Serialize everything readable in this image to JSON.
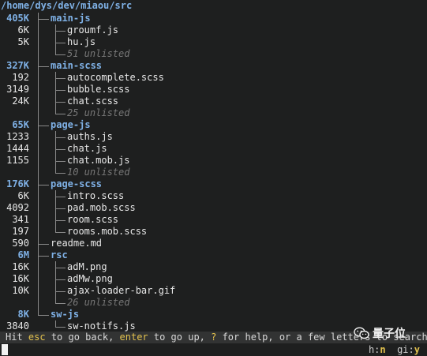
{
  "root_path": "/home/dys/dev/miaou/src",
  "rows": [
    {
      "size": "405K",
      "name": "main-js",
      "kind": "dir",
      "depth": 0
    },
    {
      "size": "6K",
      "name": "groumf.js",
      "kind": "file",
      "depth": 1
    },
    {
      "size": "5K",
      "name": "hu.js",
      "kind": "file",
      "depth": 1
    },
    {
      "size": "",
      "name": "51 unlisted",
      "kind": "unlisted",
      "depth": 1,
      "last": true
    },
    {
      "size": "327K",
      "name": "main-scss",
      "kind": "dir",
      "depth": 0
    },
    {
      "size": "192",
      "name": "autocomplete.scss",
      "kind": "file",
      "depth": 1
    },
    {
      "size": "3149",
      "name": "bubble.scss",
      "kind": "file",
      "depth": 1
    },
    {
      "size": "24K",
      "name": "chat.scss",
      "kind": "file",
      "depth": 1
    },
    {
      "size": "",
      "name": "25 unlisted",
      "kind": "unlisted",
      "depth": 1,
      "last": true
    },
    {
      "size": "65K",
      "name": "page-js",
      "kind": "dir",
      "depth": 0
    },
    {
      "size": "1233",
      "name": "auths.js",
      "kind": "file",
      "depth": 1
    },
    {
      "size": "1444",
      "name": "chat.js",
      "kind": "file",
      "depth": 1
    },
    {
      "size": "1155",
      "name": "chat.mob.js",
      "kind": "file",
      "depth": 1
    },
    {
      "size": "",
      "name": "10 unlisted",
      "kind": "unlisted",
      "depth": 1,
      "last": true
    },
    {
      "size": "176K",
      "name": "page-scss",
      "kind": "dir",
      "depth": 0
    },
    {
      "size": "6K",
      "name": "intro.scss",
      "kind": "file",
      "depth": 1
    },
    {
      "size": "4092",
      "name": "pad.mob.scss",
      "kind": "file",
      "depth": 1
    },
    {
      "size": "341",
      "name": "room.scss",
      "kind": "file",
      "depth": 1
    },
    {
      "size": "197",
      "name": "rooms.mob.scss",
      "kind": "file",
      "depth": 1,
      "last": true
    },
    {
      "size": "590",
      "name": "readme.md",
      "kind": "file",
      "depth": 0
    },
    {
      "size": "6M",
      "name": "rsc",
      "kind": "dir",
      "depth": 0
    },
    {
      "size": "16K",
      "name": "adM.png",
      "kind": "file",
      "depth": 1
    },
    {
      "size": "16K",
      "name": "adMw.png",
      "kind": "file",
      "depth": 1
    },
    {
      "size": "10K",
      "name": "ajax-loader-bar.gif",
      "kind": "file",
      "depth": 1
    },
    {
      "size": "",
      "name": "26 unlisted",
      "kind": "unlisted",
      "depth": 1,
      "last": true
    },
    {
      "size": "8K",
      "name": "sw-js",
      "kind": "dir",
      "depth": 0
    },
    {
      "size": "3840",
      "name": "sw-notifs.js",
      "kind": "file",
      "depth": 1,
      "last": true
    }
  ],
  "status": {
    "p1": "Hit ",
    "k1": "esc",
    "p2": " to go back, ",
    "k2": "enter",
    "p3": " to go up, ",
    "k3": "?",
    "p4": " for help, or a few letters to search"
  },
  "flags": {
    "h_label": "h:",
    "h_value": "n",
    "gi_label": "gi:",
    "gi_value": "y"
  },
  "watermark": {
    "text": "量子位",
    "icon": "wechat-icon"
  },
  "colors": {
    "background": "#1e1f1f",
    "directory": "#7fb1e6",
    "key_highlight": "#e3c24e",
    "unlisted": "#777777",
    "status_bar": "#323333"
  }
}
